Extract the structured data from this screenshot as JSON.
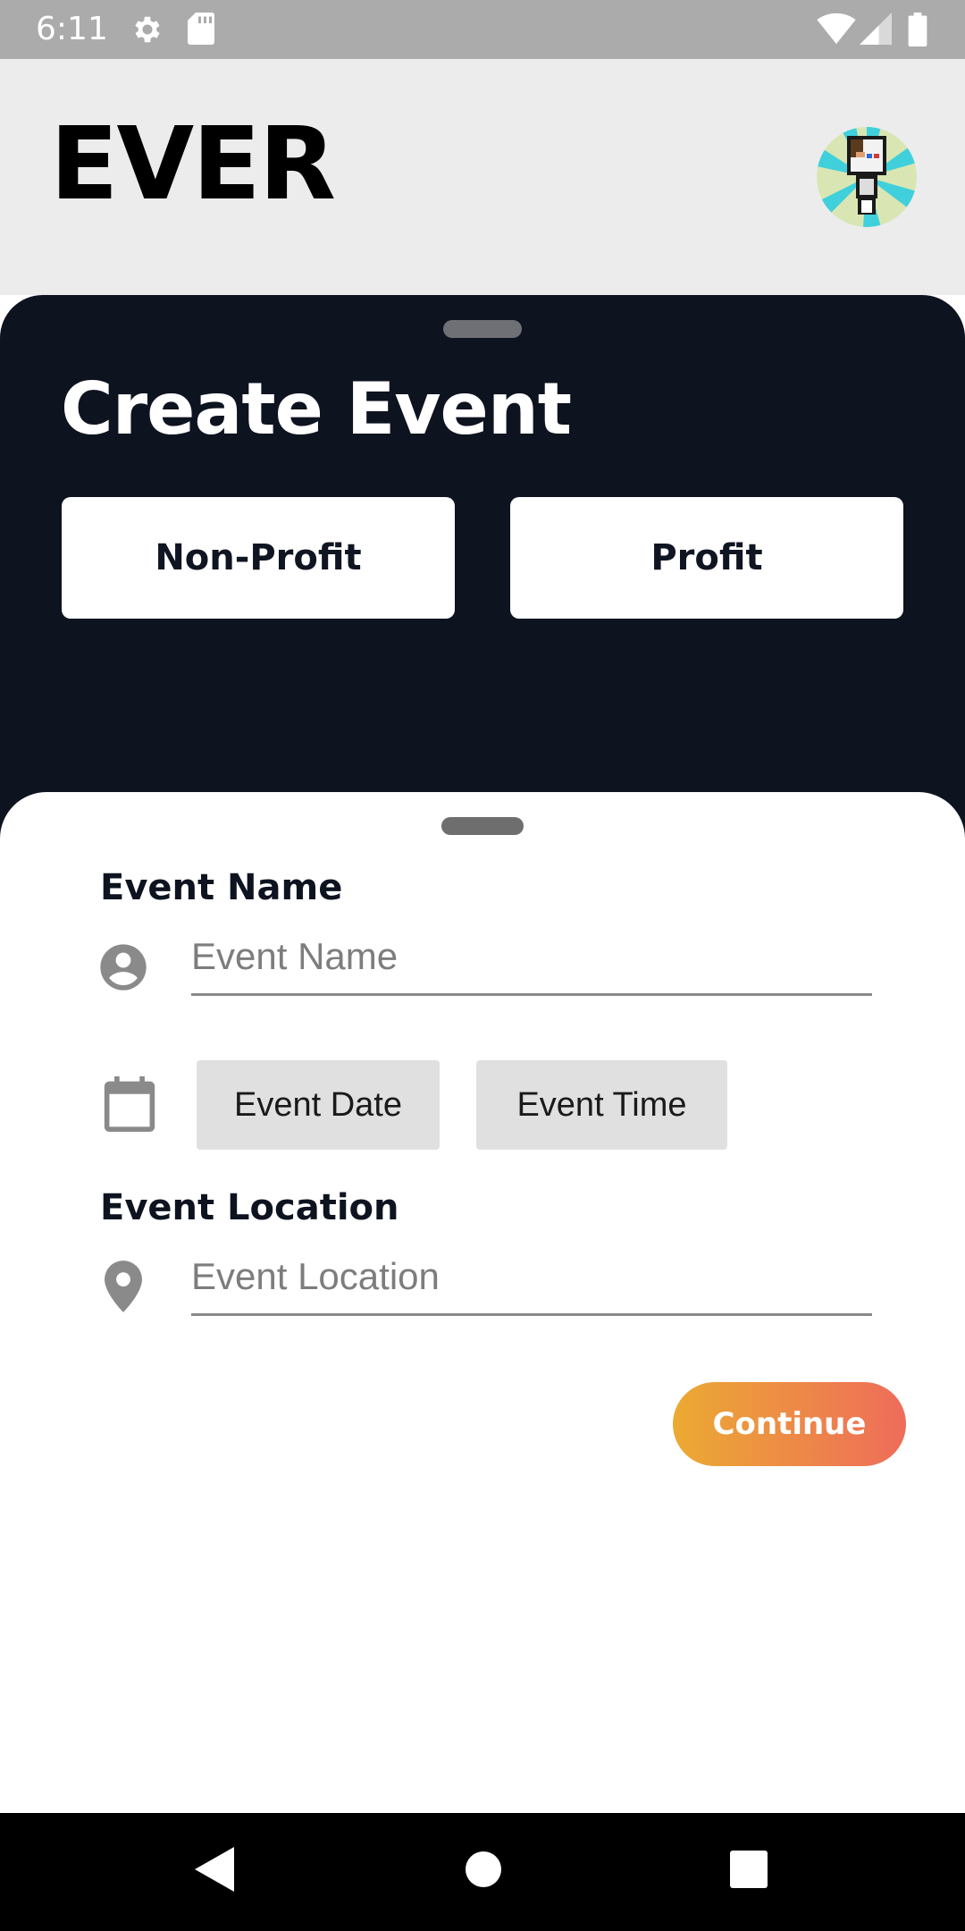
{
  "status_bar": {
    "time": "6:11",
    "icons": [
      "settings-icon",
      "sd-card-icon",
      "wifi-icon",
      "cellular-icon",
      "battery-icon"
    ]
  },
  "header": {
    "app_title": "EVER",
    "avatar": "pixel-art-avatar"
  },
  "event_sheet": {
    "title": "Create Event",
    "type_options": [
      "Non-Profit",
      "Profit"
    ]
  },
  "form": {
    "name_label": "Event Name",
    "name_placeholder": "Event Name",
    "name_icon": "account-circle-icon",
    "date_icon": "calendar-icon",
    "date_button": "Event Date",
    "time_button": "Event Time",
    "location_label": "Event Location",
    "location_placeholder": "Event Location",
    "location_icon": "location-pin-icon",
    "continue_button": "Continue"
  },
  "nav": {
    "icons": [
      "back-icon",
      "home-icon",
      "recents-icon"
    ]
  },
  "colors": {
    "status_bar": "#ababab",
    "header_bg": "#ececec",
    "dark_sheet": "#0e1320",
    "continue_gradient_start": "#ecaa32",
    "continue_gradient_end": "#ee6c5a",
    "nav_bar": "#000000"
  }
}
